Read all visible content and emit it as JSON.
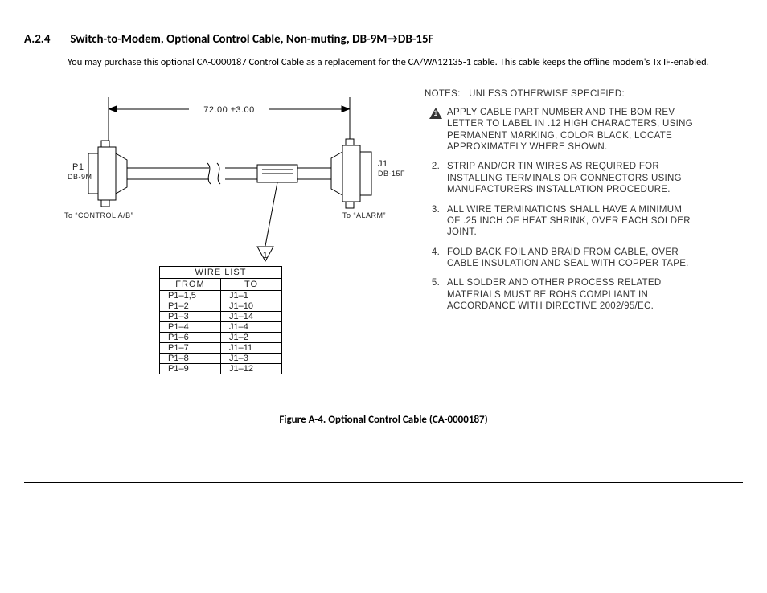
{
  "section_number": "A.2.4",
  "section_title": "Switch-to-Modem, Optional Control Cable, Non-muting, DB-9M→DB-15F",
  "body": "You may purchase this optional CA-0000187 Control Cable as a replacement for the CA/WA12135-1 cable. This cable keeps the offline modem's Tx IF-enabled.",
  "dimension": "72.00 ±3.00",
  "left_conn": {
    "ref": "P1",
    "type": "DB-9M",
    "to": "To “CONTROL A/B”"
  },
  "right_conn": {
    "ref": "J1",
    "type": "DB-15F",
    "to": "To “ALARM”"
  },
  "flag": "1",
  "notes_title": "NOTES:   UNLESS OTHERWISE SPECIFIED:",
  "notes": [
    {
      "n": "1",
      "flag": true,
      "t": "Apply cable part number and the BOM rev letter to label in .12 high characters, using permanent marking, color black, locate approximately where shown."
    },
    {
      "n": "2.",
      "flag": false,
      "t": "Strip and/or tin wires as required for installing terminals or connectors using manufacturers installation procedure."
    },
    {
      "n": "3.",
      "flag": false,
      "t": "All wire terminations shall have a minimum of .25 inch of heat shrink, over each solder joint."
    },
    {
      "n": "4.",
      "flag": false,
      "t": "Fold back foil and braid from cable, over cable insulation and seal with copper tape."
    },
    {
      "n": "5.",
      "flag": false,
      "t": "All solder and other process related materials must be RoHS compliant in accordance with directive 2002/95/EC."
    }
  ],
  "wire_list_title": "WIRE LIST",
  "wire_headers": {
    "from": "FROM",
    "to": "TO"
  },
  "wires": [
    {
      "from": "P1–1,5",
      "to": "J1–1"
    },
    {
      "from": "P1–2",
      "to": "J1–10"
    },
    {
      "from": "P1–3",
      "to": "J1–14"
    },
    {
      "from": "P1–4",
      "to": "J1–4"
    },
    {
      "from": "P1–6",
      "to": "J1–2"
    },
    {
      "from": "P1–7",
      "to": "J1–11"
    },
    {
      "from": "P1–8",
      "to": "J1–3"
    },
    {
      "from": "P1–9",
      "to": "J1–12"
    }
  ],
  "caption": "Figure A-4. Optional Control Cable (CA-0000187)"
}
